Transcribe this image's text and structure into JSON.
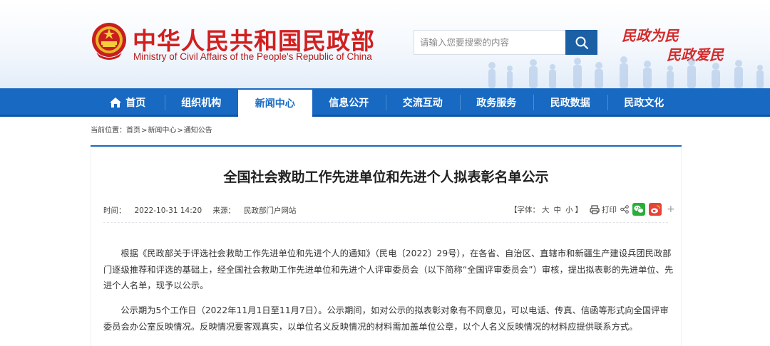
{
  "site": {
    "title": "中华人民共和国民政部",
    "subtitle": "Ministry of Civil Affairs of the People's Republic of China",
    "slogan_line1": "民政为民",
    "slogan_line2": "民政爱民"
  },
  "search": {
    "placeholder": "请输入您要搜索的内容",
    "button_icon": "search-icon"
  },
  "nav": {
    "items": [
      {
        "label": "首页",
        "icon": "home-icon"
      },
      {
        "label": "组织机构"
      },
      {
        "label": "新闻中心",
        "active": true
      },
      {
        "label": "信息公开"
      },
      {
        "label": "交流互动"
      },
      {
        "label": "政务服务"
      },
      {
        "label": "民政数据"
      },
      {
        "label": "民政文化"
      }
    ]
  },
  "breadcrumb": {
    "prefix": "当前位置：",
    "items": [
      "首页",
      "新闻中心",
      "通知公告"
    ],
    "separator": ">"
  },
  "article": {
    "title": "全国社会救助工作先进单位和先进个人拟表彰名单公示",
    "time_label": "时间：",
    "time": "2022-10-31 14:20",
    "source_label": "来源：",
    "source": "民政部门户网站",
    "font_size_label": "【字体：",
    "font_size_options": [
      "大",
      "中",
      "小"
    ],
    "font_size_close": "】",
    "print_label": "打印",
    "share_icons": [
      "share-icon",
      "wechat-icon",
      "weibo-icon",
      "plus-icon"
    ],
    "paragraphs": [
      "根据《民政部关于评选社会救助工作先进单位和先进个人的通知》（民电〔2022〕29号），在各省、自治区、直辖市和新疆生产建设兵团民政部门逐级推荐和评选的基础上，经全国社会救助工作先进单位和先进个人评审委员会（以下简称“全国评审委员会”）审核，提出拟表彰的先进单位、先进个人名单，现予以公示。",
      "公示期为5个工作日（2022年11月1日至11月7日）。公示期间，如对公示的拟表彰对象有不同意见，可以电话、传真、信函等形式向全国评审委员会办公室反映情况。反映情况要客观真实，以单位名义反映情况的材料需加盖单位公章，以个人名义反映情况的材料应提供联系方式。"
    ]
  },
  "colors": {
    "brand_red": "#d21f1f",
    "nav_blue": "#1769c2",
    "search_button": "#1b5fa5"
  }
}
